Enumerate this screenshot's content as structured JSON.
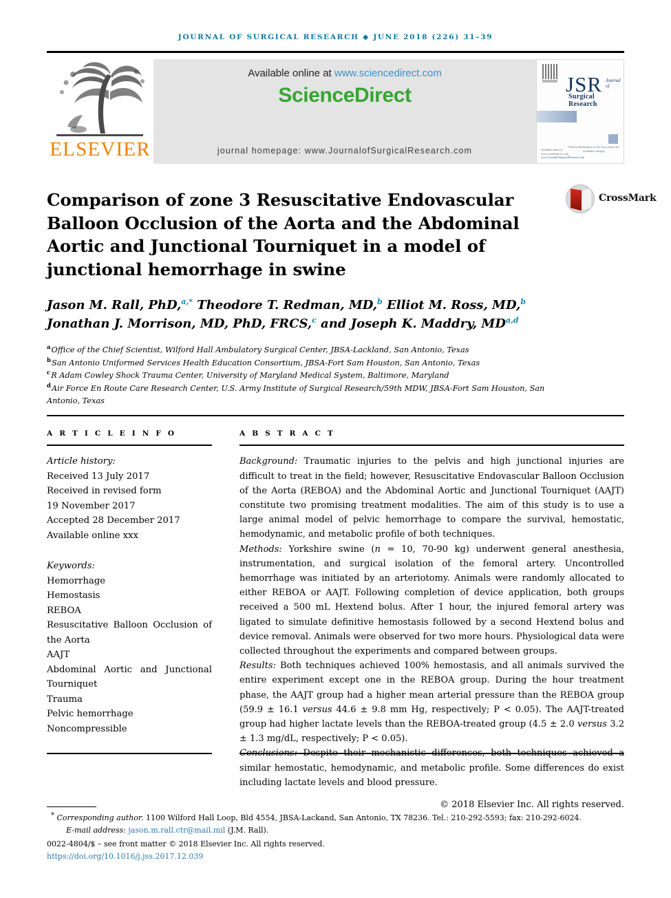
{
  "running_head": "JOURNAL OF SURGICAL RESEARCH ◆ JUNE 2018 (226) 31–39",
  "masthead": {
    "publisher_logo_name": "elsevier-tree-logo",
    "publisher_wordmark": "ELSEVIER",
    "available_online_prefix": "Available online at ",
    "available_online_url": "www.sciencedirect.com",
    "sciencedirect_wordmark": "ScienceDirect",
    "journal_homepage": "journal homepage: www.JournalofSurgicalResearch.com",
    "cover": {
      "title": "JSR",
      "superscript": "Journal of",
      "subtitle": "Surgical Research",
      "association": "Official Publication of the Association for Academic Surgery",
      "footer_line1": "Available online at www.sciencedirect.com",
      "footer_line2": "www.JournalofSurgicalResearch.com"
    }
  },
  "article": {
    "title": "Comparison of zone 3 Resuscitative Endovascular Balloon Occlusion of the Aorta and the Abdominal Aortic and Junctional Tourniquet in a model of junctional hemorrhage in swine",
    "crossmark_label": "CrossMark",
    "authors_line1_a": "Jason M. Rall, PhD,",
    "authors_line1_a_sup": "a,*",
    "authors_line1_b": " Theodore T. Redman, MD,",
    "authors_line1_b_sup": "b",
    "authors_line1_c": " Elliot M. Ross, MD,",
    "authors_line1_c_sup": "b",
    "authors_line2_a": "Jonathan J. Morrison, MD, PhD, FRCS,",
    "authors_line2_a_sup": "c",
    "authors_line2_b": " and Joseph K. Maddry, MD",
    "authors_line2_b_sup": "a,d",
    "affiliations": [
      {
        "mark": "a",
        "text": "Office of the Chief Scientist, Wilford Hall Ambulatory Surgical Center, JBSA-Lackland, San Antonio, Texas"
      },
      {
        "mark": "b",
        "text": "San Antonio Uniformed Services Health Education Consortium, JBSA-Fort Sam Houston, San Antonio, Texas"
      },
      {
        "mark": "c",
        "text": "R Adam Cowley Shock Trauma Center, University of Maryland Medical System, Baltimore, Maryland"
      },
      {
        "mark": "d",
        "text": "Air Force En Route Care Research Center, U.S. Army Institute of Surgical Research/59th MDW, JBSA-Fort Sam Houston, San Antonio, Texas"
      }
    ]
  },
  "article_info": {
    "heading": "A R T I C L E   I N F O",
    "history_label": "Article history:",
    "history": [
      "Received 13 July 2017",
      "Received in revised form",
      "19 November 2017",
      "Accepted 28 December 2017",
      "Available online xxx"
    ],
    "keywords_label": "Keywords:",
    "keywords": [
      "Hemorrhage",
      "Hemostasis",
      "REBOA",
      "Resuscitative Balloon Occlusion of the Aorta",
      "AAJT",
      "Abdominal Aortic and Junctional Tourniquet",
      "Trauma",
      "Pelvic hemorrhage",
      "Noncompressible"
    ]
  },
  "abstract": {
    "heading": "A B S T R A C T",
    "background_label": "Background:",
    "background_text": " Traumatic injuries to the pelvis and high junctional injuries are difficult to treat in the field; however, Resuscitative Endovascular Balloon Occlusion of the Aorta (REBOA) and the Abdominal Aortic and Junctional Tourniquet (AAJT) constitute two promising treatment modalities. The aim of this study is to use a large animal model of pelvic hemorrhage to compare the survival, hemostatic, hemodynamic, and metabolic profile of both techniques.",
    "methods_label": "Methods:",
    "methods_p1": " Yorkshire swine (",
    "methods_n": "n",
    "methods_p2": " = 10, 70-90 kg) underwent general anesthesia, instrumentation, and surgical isolation of the femoral artery. Uncontrolled hemorrhage was initiated by an arteriotomy. Animals were randomly allocated to either REBOA or AAJT. Following completion of device application, both groups received a 500 mL Hextend bolus. After 1 hour, the injured femoral artery was ligated to simulate definitive hemostasis followed by a second Hextend bolus and device removal. Animals were observed for two more hours. Physiological data were collected throughout the experiments and compared between groups.",
    "results_label": "Results:",
    "results_p1": " Both techniques achieved 100% hemostasis, and all animals survived the entire experiment except one in the REBOA group. During the hour treatment phase, the AAJT group had a higher mean arterial pressure than the REBOA group (59.9 ± 16.1 ",
    "results_versus1": "versus",
    "results_p2": " 44.6 ± 9.8 mm Hg, respectively; P < 0.05). The AAJT-treated group had higher lactate levels than the REBOA-treated group (4.5 ± 2.0 ",
    "results_versus2": "versus",
    "results_p3": " 3.2 ± 1.3 mg/dL, respectively; P < 0.05).",
    "conclusions_label": "Conclusions:",
    "conclusions_text": " Despite their mechanistic differences, both techniques achieved a similar hemostatic, hemodynamic, and metabolic profile. Some differences do exist including lactate levels and blood pressure.",
    "copyright": "© 2018 Elsevier Inc. All rights reserved."
  },
  "footer": {
    "corresponding_star": "*",
    "corresponding_label": " Corresponding author. ",
    "corresponding_address": "1100 Wilford Hall Loop, Bld 4554, JBSA-Lackand, San Antonio, TX 78236. Tel.: 210-292-5593; fax: 210-292-6024.",
    "email_label": "E-mail address: ",
    "email": "jason.m.rall.ctr@mail.mil",
    "email_suffix": " (J.M. Rall).",
    "front_matter": "0022-4804/$ – see front matter © 2018 Elsevier Inc. All rights reserved.",
    "doi": "https://doi.org/10.1016/j.jss.2017.12.039"
  },
  "colors": {
    "running_head": "#0b7aa8",
    "elsevier_orange": "#f08000",
    "sciencedirect_green": "#35a532",
    "link_blue": "#2a7ab0",
    "sup_blue": "#1186b7",
    "banner_gray": "#e4e4e4",
    "jsr_navy": "#13365e"
  }
}
